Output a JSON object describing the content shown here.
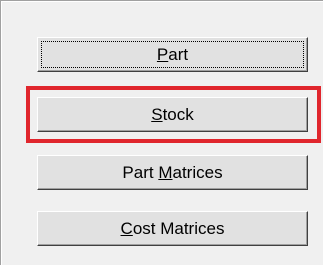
{
  "buttons": [
    {
      "id": "part",
      "pre": "",
      "key": "P",
      "post": "art",
      "focused": true
    },
    {
      "id": "stock",
      "pre": "",
      "key": "S",
      "post": "tock",
      "focused": false,
      "highlighted": true
    },
    {
      "id": "part-matrices",
      "pre": "Part ",
      "key": "M",
      "post": "atrices",
      "focused": false
    },
    {
      "id": "cost-matrices",
      "pre": "",
      "key": "C",
      "post": "ost Matrices",
      "focused": false
    }
  ],
  "highlight_color": "#e0262d"
}
